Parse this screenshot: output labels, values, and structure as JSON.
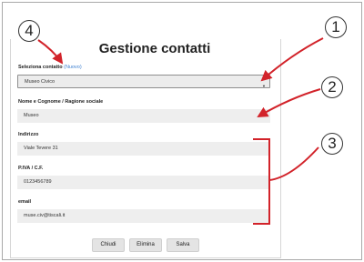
{
  "dialog": {
    "title": "Gestione contatti"
  },
  "contact_select": {
    "label": "Seleziona contatto",
    "new_link": "(Nuovo)",
    "value": "Museo Civico"
  },
  "name_field": {
    "label": "Nome e Cognome / Ragione sociale",
    "value": "Museo"
  },
  "address_field": {
    "label": "Indirizzo",
    "value": "Viale Tevere 31"
  },
  "vat_field": {
    "label": "P.IVA / C.F.",
    "value": "0123456789"
  },
  "email_field": {
    "label": "email",
    "value": "muse.civ@tiscali.it"
  },
  "buttons": {
    "close": "Chiudi",
    "delete": "Elimina",
    "save": "Salva"
  },
  "callouts": {
    "one": "1",
    "two": "2",
    "three": "3",
    "four": "4"
  },
  "colors": {
    "callout_arrow": "#d2232a",
    "link": "#3b7fd1"
  }
}
